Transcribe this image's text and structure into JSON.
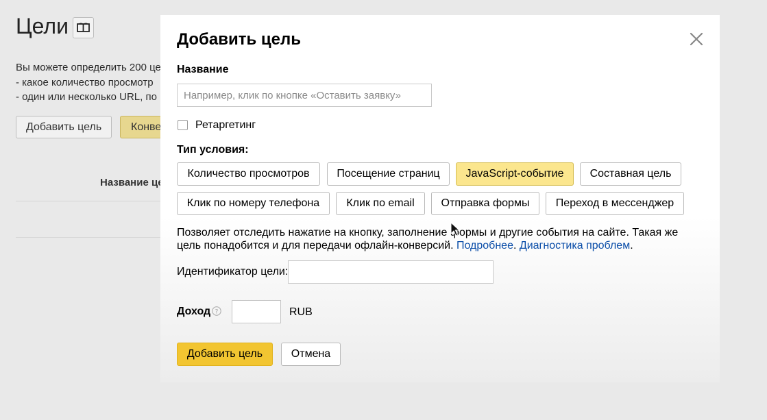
{
  "background": {
    "title": "Цели",
    "description_lines": [
      "Вы можете определить 200 це",
      "-  какое количество просмотр",
      "-  один или несколько URL, по"
    ],
    "add_goal_button": "Добавить цель",
    "conversion_button": "Конве",
    "table_header": "Название це"
  },
  "modal": {
    "title": "Добавить цель",
    "name_label": "Название",
    "name_placeholder": "Например, клик по кнопке «Оставить заявку»",
    "name_value": "",
    "retargeting_label": "Ретаргетинг",
    "retargeting_checked": false,
    "condition_type_label": "Тип условия:",
    "condition_types": [
      "Количество просмотров",
      "Посещение страниц",
      "JavaScript-событие",
      "Составная цель",
      "Клик по номеру телефона",
      "Клик по email",
      "Отправка формы",
      "Переход в мессенджер"
    ],
    "selected_condition_type": "JavaScript-событие",
    "hint_text": "Позволяет отследить нажатие на кнопку, заполнение формы и другие события на сайте. Такая же цель понадобится и для передачи офлайн-конверсий.",
    "hint_link_more": "Подробнее",
    "hint_link_diagnostics": "Диагностика проблем",
    "goal_id_label": "Идентификатор цели:",
    "goal_id_value": "",
    "income_label": "Доход",
    "income_value": "",
    "currency": "RUB",
    "submit_button": "Добавить цель",
    "cancel_button": "Отмена"
  },
  "colors": {
    "primary_button": "#f2c531",
    "selected_type": "#fbe68e",
    "link": "#0a4da8"
  }
}
